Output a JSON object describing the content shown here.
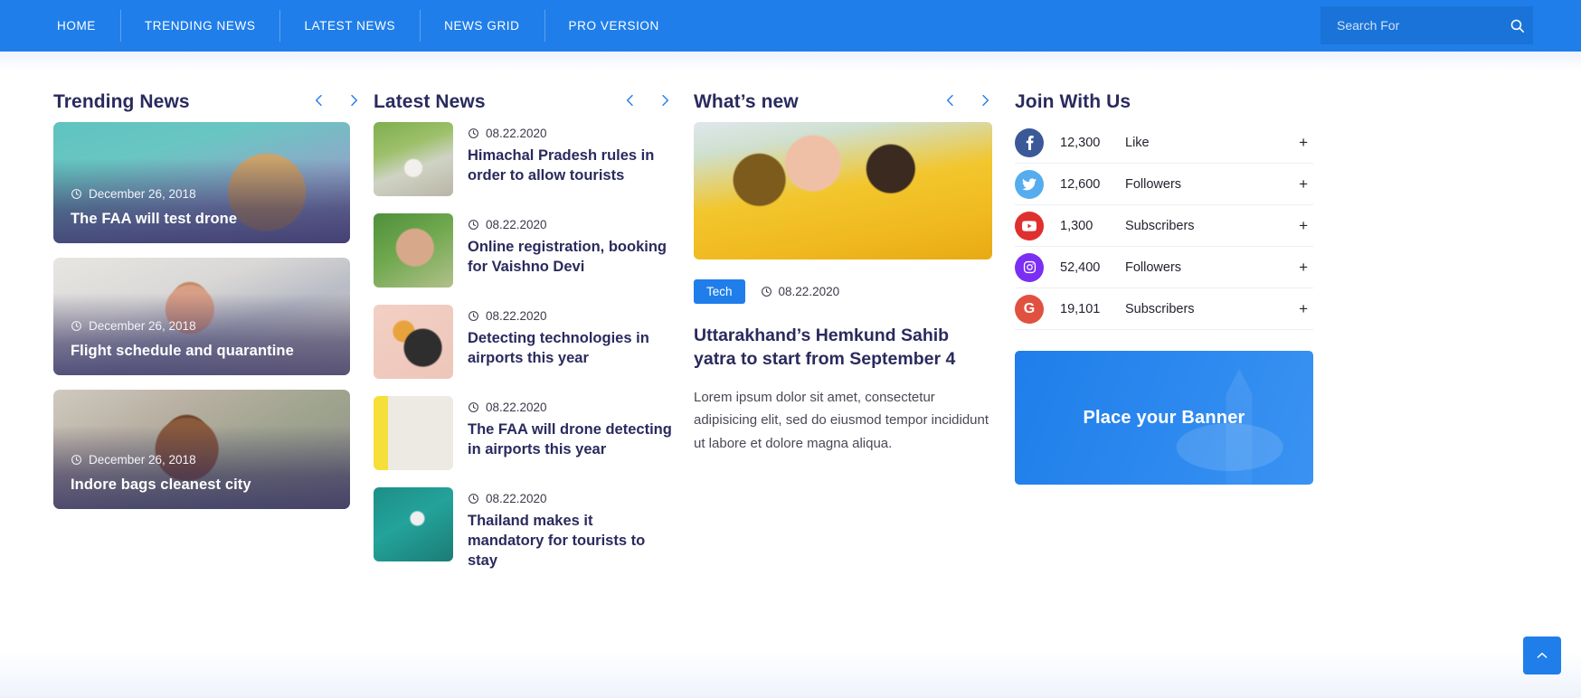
{
  "header": {
    "nav": [
      {
        "label": "HOME"
      },
      {
        "label": "TRENDING NEWS"
      },
      {
        "label": "LATEST NEWS"
      },
      {
        "label": "NEWS GRID"
      },
      {
        "label": "PRO VERSION"
      }
    ],
    "search": {
      "placeholder": "Search For",
      "value": "",
      "icon": "search-icon"
    },
    "bg_color": "#1f7eea"
  },
  "trending": {
    "title": "Trending News",
    "prev_icon": "chevron-left-icon",
    "next_icon": "chevron-right-icon",
    "cards": [
      {
        "date": "December 26, 2018",
        "title": "The FAA will test drone"
      },
      {
        "date": "December 26, 2018",
        "title": "Flight schedule and quarantine"
      },
      {
        "date": "December 26, 2018",
        "title": "Indore bags cleanest city"
      }
    ]
  },
  "latest": {
    "title": "Latest News",
    "prev_icon": "chevron-left-icon",
    "next_icon": "chevron-right-icon",
    "items": [
      {
        "date": "08.22.2020",
        "title": "Himachal Pradesh rules in order to allow tourists"
      },
      {
        "date": "08.22.2020",
        "title": "Online registration, booking for Vaishno Devi"
      },
      {
        "date": "08.22.2020",
        "title": "Detecting technologies in airports this year"
      },
      {
        "date": "08.22.2020",
        "title": "The FAA will drone detecting in airports this year"
      },
      {
        "date": "08.22.2020",
        "title": "Thailand makes it mandatory for tourists to stay"
      }
    ]
  },
  "whats_new": {
    "title": "What’s new",
    "prev_icon": "chevron-left-icon",
    "next_icon": "chevron-right-icon",
    "category": "Tech",
    "category_color": "#1f7eea",
    "date": "08.22.2020",
    "headline": "Uttarakhand’s Hemkund Sahib yatra to start from September 4",
    "excerpt": "Lorem ipsum dolor sit amet, consectetur adipisicing elit, sed do eiusmod tempor incididunt ut labore et dolore magna aliqua."
  },
  "join": {
    "title": "Join With Us",
    "socials": [
      {
        "icon": "facebook-icon",
        "count": "12,300",
        "label": "Like",
        "color": "#3b5998",
        "plus": "+"
      },
      {
        "icon": "twitter-icon",
        "count": "12,600",
        "label": "Followers",
        "color": "#55acee",
        "plus": "+"
      },
      {
        "icon": "youtube-icon",
        "count": "1,300",
        "label": "Subscribers",
        "color": "#e02f2f",
        "plus": "+"
      },
      {
        "icon": "instagram-icon",
        "count": "52,400",
        "label": "Followers",
        "color": "#7b2ff2",
        "plus": "+"
      },
      {
        "icon": "google-icon",
        "count": "19,101",
        "label": "Subscribers",
        "color": "#e0513f",
        "plus": "+"
      }
    ],
    "banner": {
      "text": "Place your Banner",
      "color": "#1f7eea"
    }
  },
  "scroll_top": {
    "icon": "chevron-up-icon",
    "color": "#1f7eea"
  }
}
